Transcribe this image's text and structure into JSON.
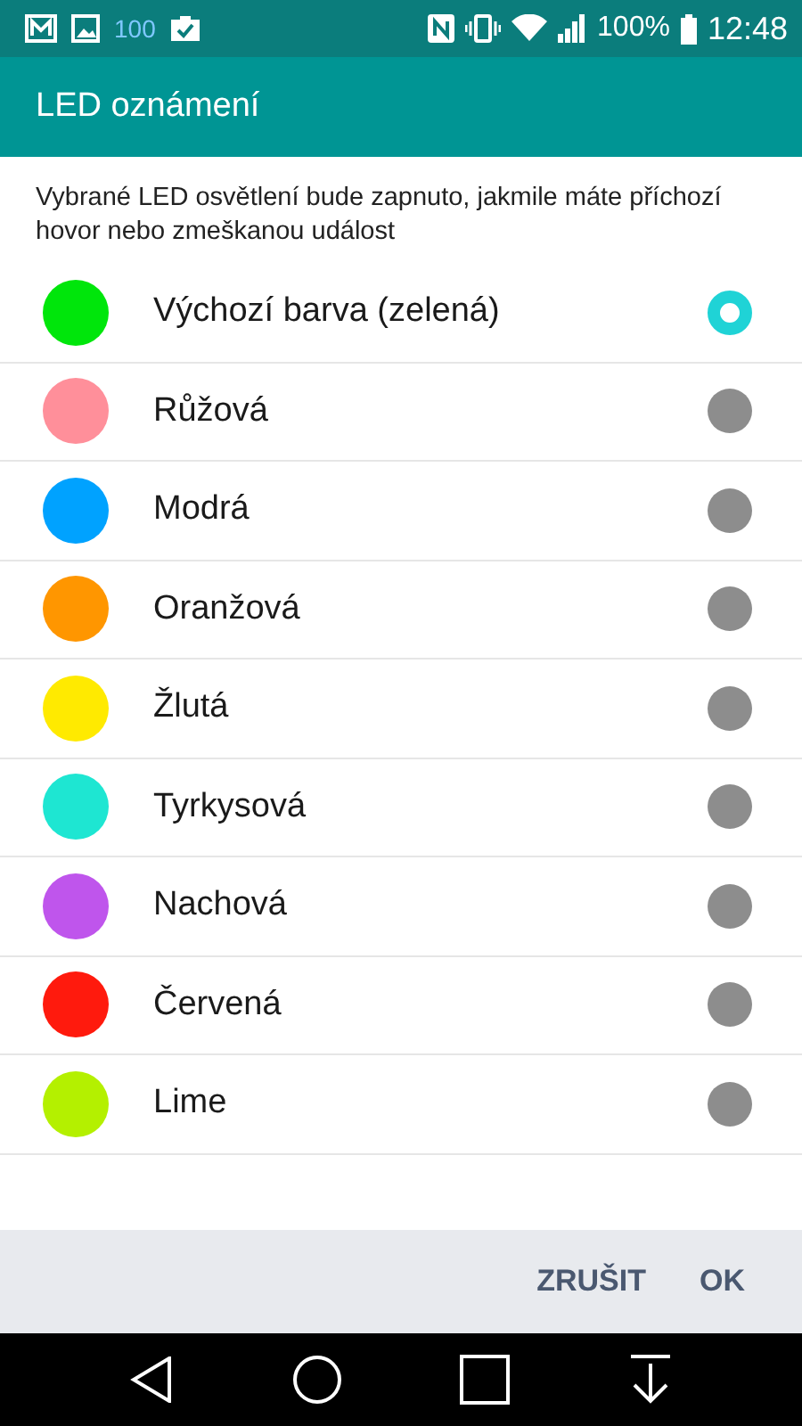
{
  "status_bar": {
    "notification_count": "100",
    "battery": "100%",
    "time": "12:48"
  },
  "title": "LED oznámení",
  "description": "Vybrané LED osvětlení bude zapnuto, jakmile máte příchozí hovor nebo zmeškanou událost",
  "options": [
    {
      "label": "Výchozí barva (zelená)",
      "color": "#00e60b",
      "selected": true
    },
    {
      "label": "Růžová",
      "color": "#ff8f9a",
      "selected": false
    },
    {
      "label": "Modrá",
      "color": "#00a2ff",
      "selected": false
    },
    {
      "label": "Oranžová",
      "color": "#ff9600",
      "selected": false
    },
    {
      "label": "Žlutá",
      "color": "#ffea00",
      "selected": false
    },
    {
      "label": "Tyrkysová",
      "color": "#1ee6d2",
      "selected": false
    },
    {
      "label": "Nachová",
      "color": "#bf55ec",
      "selected": false
    },
    {
      "label": "Červená",
      "color": "#ff1a0d",
      "selected": false
    },
    {
      "label": "Lime",
      "color": "#b4f000",
      "selected": false
    }
  ],
  "buttons": [
    "ZRUŠIT",
    "OK"
  ]
}
